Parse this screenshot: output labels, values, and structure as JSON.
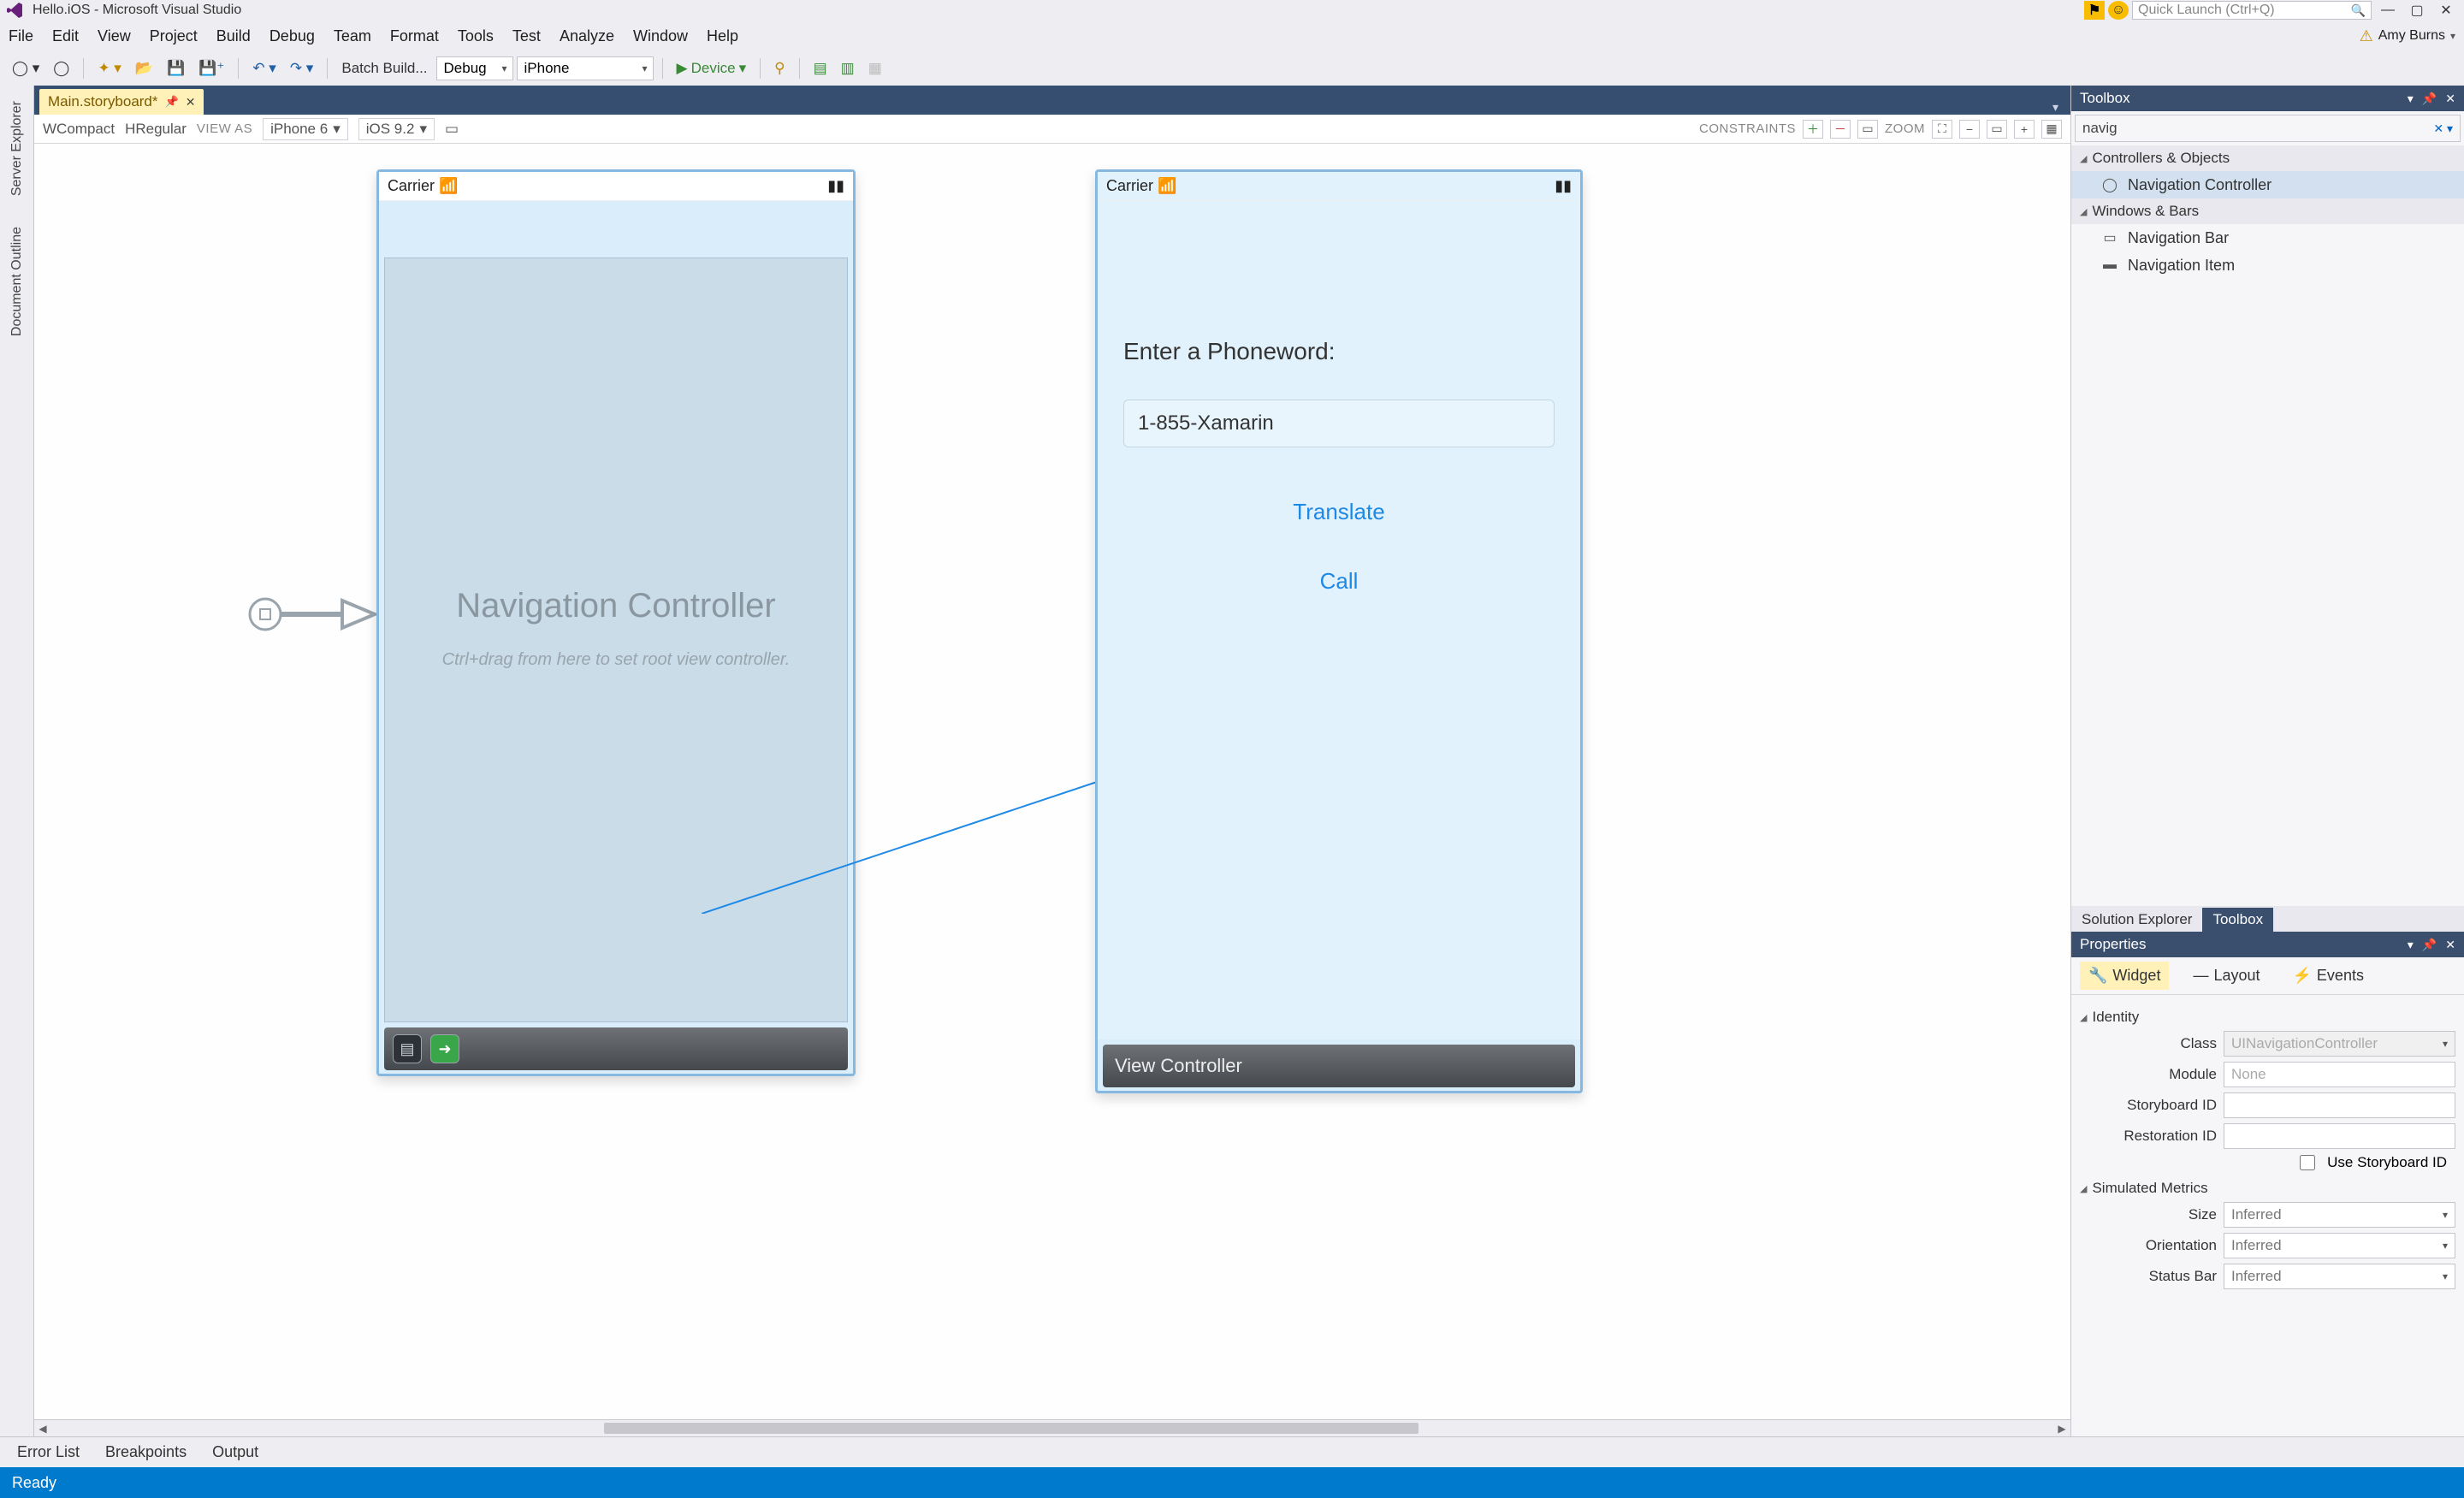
{
  "title": "Hello.iOS - Microsoft Visual Studio",
  "quick_launch_placeholder": "Quick Launch (Ctrl+Q)",
  "user_name": "Amy Burns",
  "menu": [
    "File",
    "Edit",
    "View",
    "Project",
    "Build",
    "Debug",
    "Team",
    "Format",
    "Tools",
    "Test",
    "Analyze",
    "Window",
    "Help"
  ],
  "toolbar": {
    "batch_build": "Batch Build...",
    "config": "Debug",
    "platform": "iPhone",
    "device": "Device"
  },
  "doc_tab": "Main.storyboard*",
  "size_class": {
    "w": "WCompact",
    "h": "HRegular",
    "view_as": "VIEW AS",
    "device": "iPhone 6",
    "os": "iOS 9.2"
  },
  "constraints_label": "CONSTRAINTS",
  "zoom_label": "ZOOM",
  "scene_nav": {
    "carrier": "Carrier",
    "title": "Navigation Controller",
    "hint": "Ctrl+drag from here to set root view controller."
  },
  "scene_view": {
    "carrier": "Carrier",
    "label": "Enter a Phoneword:",
    "field_value": "1-855-Xamarin",
    "translate": "Translate",
    "call": "Call",
    "footer": "View Controller"
  },
  "left_rails": [
    "Server Explorer",
    "Document Outline"
  ],
  "toolbox": {
    "title": "Toolbox",
    "search": "navig",
    "cat1": "Controllers & Objects",
    "item1": "Navigation Controller",
    "cat2": "Windows & Bars",
    "item2": "Navigation Bar",
    "item3": "Navigation Item",
    "bottom_tabs": [
      "Solution Explorer",
      "Toolbox"
    ]
  },
  "properties": {
    "title": "Properties",
    "tabs": [
      "Widget",
      "Layout",
      "Events"
    ],
    "group_identity": "Identity",
    "class_label": "Class",
    "class_value": "UINavigationController",
    "module_label": "Module",
    "module_placeholder": "None",
    "storyboard_id_label": "Storyboard ID",
    "restoration_id_label": "Restoration ID",
    "use_storyboard_id": "Use Storyboard ID",
    "group_sim": "Simulated Metrics",
    "size_label": "Size",
    "size_value": "Inferred",
    "orientation_label": "Orientation",
    "orientation_value": "Inferred",
    "statusbar_label": "Status Bar",
    "statusbar_value": "Inferred"
  },
  "bottom_tabs": [
    "Error List",
    "Breakpoints",
    "Output"
  ],
  "status": "Ready"
}
